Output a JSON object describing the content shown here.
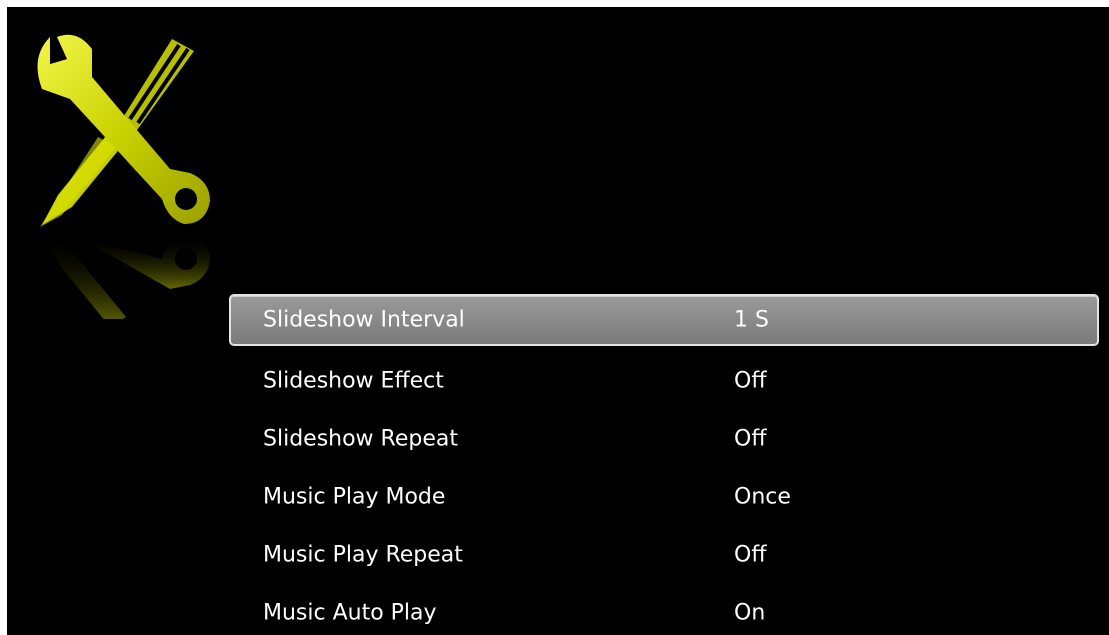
{
  "icons": {
    "settings": "wrench-screwdriver-icon"
  },
  "colors": {
    "background": "#000000",
    "icon_accent": "#c8d400",
    "selection": "#8a8a8a",
    "text": "#ffffff"
  },
  "menu": {
    "items": [
      {
        "label": "Slideshow Interval",
        "value": "1 S",
        "selected": true
      },
      {
        "label": "Slideshow Effect",
        "value": "Off",
        "selected": false
      },
      {
        "label": "Slideshow Repeat",
        "value": "Off",
        "selected": false
      },
      {
        "label": "Music Play Mode",
        "value": "Once",
        "selected": false
      },
      {
        "label": "Music Play Repeat",
        "value": "Off",
        "selected": false
      },
      {
        "label": "Music Auto Play",
        "value": "On",
        "selected": false
      }
    ]
  }
}
